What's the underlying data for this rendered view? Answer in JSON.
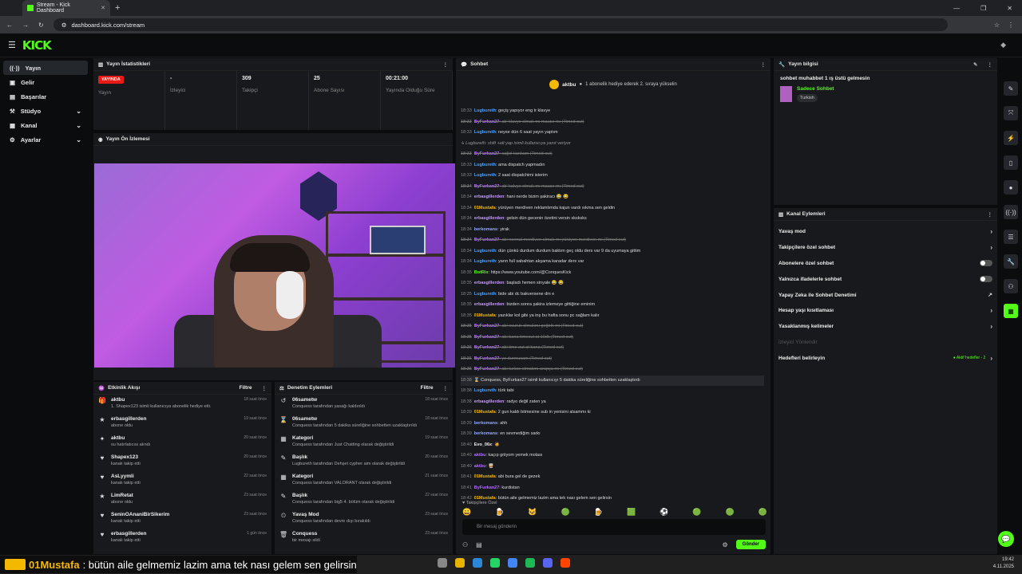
{
  "browser": {
    "tab_title": "Stream - Kick Dashboard",
    "url": "dashboard.kick.com/stream"
  },
  "app": {
    "logo": "KICK"
  },
  "sidebar": {
    "items": [
      {
        "label": "Yayın",
        "icon": "broadcast-icon",
        "active": true
      },
      {
        "label": "Gelir",
        "icon": "revenue-icon"
      },
      {
        "label": "Başarılar",
        "icon": "trophy-icon"
      },
      {
        "label": "Stüdyo",
        "icon": "studio-icon",
        "expandable": true
      },
      {
        "label": "Kanal",
        "icon": "channel-icon",
        "expandable": true
      },
      {
        "label": "Ayarlar",
        "icon": "gear-icon",
        "expandable": true
      }
    ]
  },
  "stats": {
    "title": "Yayın İstatistikleri",
    "live_badge": "YAYINDA",
    "items": [
      {
        "value": "",
        "label": "Yayın"
      },
      {
        "value": "-",
        "label": "İzleyici"
      },
      {
        "value": "309",
        "label": "Takipçi"
      },
      {
        "value": "25",
        "label": "Abone Sayısı"
      },
      {
        "value": "00:21:00",
        "label": "Yayında Olduğu Süre"
      }
    ]
  },
  "preview": {
    "title": "Yayın Ön İzlemesi"
  },
  "activity": {
    "title": "Etkinlik Akışı",
    "filter": "Filtre",
    "items": [
      {
        "name": "aktbu",
        "sub": "1. Shapex123 isimli kullanıcıya abonelik hediye etti.",
        "time": "18 saat önce"
      },
      {
        "name": "erbasgillerden",
        "sub": "abone oldu",
        "time": "19 saat önce"
      },
      {
        "name": "aktbu",
        "sub": "su hatırlatıcısı alındı",
        "time": "20 saat önce"
      },
      {
        "name": "Shapex123",
        "sub": "kanalı takip etti",
        "time": "20 saat önce"
      },
      {
        "name": "AsLyymli",
        "sub": "kanalı takip etti",
        "time": "22 saat önce"
      },
      {
        "name": "LimRetat",
        "sub": "abone oldu",
        "time": "23 saat önce"
      },
      {
        "name": "SeninOAnaniBirSikerim",
        "sub": "kanalı takip etti",
        "time": "23 saat önce"
      },
      {
        "name": "erbasgillerden",
        "sub": "kanalı takip etti",
        "time": "1 gün önce"
      }
    ]
  },
  "moderation": {
    "title": "Denetim Eylemleri",
    "filter": "Filtre",
    "items": [
      {
        "name": "06sametw",
        "sub": "Conquess tarafından yasağı kaldırıldı",
        "time": "18 saat önce"
      },
      {
        "name": "06sametw",
        "sub": "Conquess tarafından 5 dakika süreliğine sohbetten uzaklaştırıldı",
        "time": "18 saat önce"
      },
      {
        "name": "Kategori",
        "sub": "Conquess tarafından Just Chatting olarak değiştirildi",
        "time": "19 saat önce"
      },
      {
        "name": "Başlık",
        "sub": "Lugbureth tarafından Dehşet cypher aim olarak değiştirildi",
        "time": "20 saat önce"
      },
      {
        "name": "Kategori",
        "sub": "Conquess tarafından VALORANT olarak değiştirildi",
        "time": "21 saat önce"
      },
      {
        "name": "Başlık",
        "sub": "Conquess tarafından big5 4. bölüm olarak değiştirildi",
        "time": "22 saat önce"
      },
      {
        "name": "Yavaş Mod",
        "sub": "Conquess tarafından devre dışı bırakıldı",
        "time": "23 saat önce"
      },
      {
        "name": "Conquess",
        "sub": "bir mesajı sildi",
        "time": "23 saat önce"
      }
    ]
  },
  "chat": {
    "title": "Sohbet",
    "pinned_user": "aktbu",
    "pinned_text": "1 abonelik hediye ederek 2. sıraya yükselin",
    "following_note": "Takipçilere Özel",
    "placeholder": "Bir mesaj gönderin",
    "send": "Gönder",
    "messages": [
      {
        "time": "18:33",
        "user": "Lugbureth",
        "color": "#4aa3ff",
        "text": "geçiş yapıyor eng tr klavye"
      },
      {
        "time": "18:33",
        "user": "ByFurkan27",
        "color": "#b36bff",
        "text": "ab' klavye olmak mı mause mı (Timed out)",
        "del": true
      },
      {
        "time": "18:33",
        "user": "Lugbureth",
        "color": "#4aa3ff",
        "text": "neyse dün 6 saat yayın yaptım"
      },
      {
        "time": "",
        "user": "",
        "color": "#888",
        "text": "↳ Lugbureth: shift +alt yap isimli kullanıcıya yanıt veriyor",
        "sys": true
      },
      {
        "time": "18:33",
        "user": "ByFurkan27",
        "color": "#b36bff",
        "text": "sağol kankam (Timed out)",
        "del": true
      },
      {
        "time": "18:33",
        "user": "Lugbureth",
        "color": "#4aa3ff",
        "text": "ama dispatch yapmadın"
      },
      {
        "time": "18:33",
        "user": "Lugbureth",
        "color": "#4aa3ff",
        "text": "2 saat dispatchimi isterim"
      },
      {
        "time": "18:34",
        "user": "ByFurkan27",
        "color": "#b36bff",
        "text": "ab' kalvye olmak mı mause mı (Timed out)",
        "del": true
      },
      {
        "time": "18:34",
        "user": "erbasgillerden",
        "color": "#c79aff",
        "text": "hani nerde bizim şakiracı 😂 😂"
      },
      {
        "time": "18:34",
        "user": "01Mustafa",
        "color": "#f5b800",
        "text": "yürüyen merdiven reklamlımda kajun vardı sıkma sen geldin"
      },
      {
        "time": "18:34",
        "user": "erbasgillerden",
        "color": "#c79aff",
        "text": "gelsin dün gecenin özetini versin sksksks"
      },
      {
        "time": "18:34",
        "user": "berkomans",
        "color": "#8fa7ff",
        "text": "yirak"
      },
      {
        "time": "18:34",
        "user": "ByFurkan27",
        "color": "#b36bff",
        "text": "abi normal merdiven olmak mı yürüyen merdiven mi (Timed out)",
        "del": true
      },
      {
        "time": "18:34",
        "user": "Lugbureth",
        "color": "#4aa3ff",
        "text": "dün çünkü durdum durdum baktım geç oldu ders var 9 da uyumaya gittim"
      },
      {
        "time": "18:34",
        "user": "Lugbureth",
        "color": "#4aa3ff",
        "text": "yarın full sabahtan akşama karadar ders var"
      },
      {
        "time": "18:35",
        "user": "BotRix",
        "color": "#53fc18",
        "text": "https://www.youtube.com/@ConquesKick"
      },
      {
        "time": "18:35",
        "user": "erbasgillerden",
        "color": "#c79aff",
        "text": "başladı hemen sinyale 😂 😂"
      },
      {
        "time": "18:35",
        "user": "Lugbureth",
        "color": "#4aa3ff",
        "text": "bide abi dc bakversene dm e"
      },
      {
        "time": "18:35",
        "user": "erbasgillerden",
        "color": "#c79aff",
        "text": "bizden sonra şakira izlemeye gittiğine eminim"
      },
      {
        "time": "18:35",
        "user": "01Mustafa",
        "color": "#f5b800",
        "text": "yazıklar kol gibi ya inş bu hafta sonu pc sağlam kalır"
      },
      {
        "time": "18:35",
        "user": "ByFurkan27",
        "color": "#b36bff",
        "text": "abi osuruk olmakmı geğirik mi (Timed out)",
        "del": true
      },
      {
        "time": "18:35",
        "user": "ByFurkan27",
        "color": "#b36bff",
        "text": "abi bana timeout at 10dk (Timed out)",
        "del": true
      },
      {
        "time": "18:36",
        "user": "ByFurkan27",
        "color": "#b36bff",
        "text": "abi time out at bana (Timed out)",
        "del": true
      },
      {
        "time": "18:36",
        "user": "ByFurkan27",
        "color": "#b36bff",
        "text": "yo durmucam (Timed out)",
        "del": true
      },
      {
        "time": "18:36",
        "user": "ByFurkan27",
        "color": "#b36bff",
        "text": "abi turkce olmakmı arapça mı (Timed out)",
        "del": true
      },
      {
        "time": "18:38",
        "user": "",
        "color": "#eee",
        "text": "⌛ Conquess, ByFurkan27 isimli kullanıcıyı 5 dakika süreliğine sohbetten uzaklaştırdı",
        "hl": true
      },
      {
        "time": "18:38",
        "user": "Lugbureth",
        "color": "#4aa3ff",
        "text": "türk tabi"
      },
      {
        "time": "18:38",
        "user": "erbasgillerden",
        "color": "#c79aff",
        "text": "radyo değil zaten ya"
      },
      {
        "time": "18:39",
        "user": "01Mustafa",
        "color": "#f5b800",
        "text": "2 gun kaldı bitmesine sub in yenisini alsammı ki"
      },
      {
        "time": "18:39",
        "user": "berkomans",
        "color": "#8fa7ff",
        "text": "ahh"
      },
      {
        "time": "18:39",
        "user": "berkomans",
        "color": "#8fa7ff",
        "text": "en sevmediğim sarkı"
      },
      {
        "time": "18:40",
        "user": "Evo_06x",
        "color": "#eeeeee",
        "text": "🧔"
      },
      {
        "time": "18:40",
        "user": "aktbu",
        "color": "#b36bff",
        "text": "kaçıp griiyom yemek molası"
      },
      {
        "time": "18:40",
        "user": "aktbu",
        "color": "#b36bff",
        "text": "🥃"
      },
      {
        "time": "18:41",
        "user": "01Mustafa",
        "color": "#f5b800",
        "text": "abi bura gel de gezek"
      },
      {
        "time": "18:41",
        "user": "ByFurkan27",
        "color": "#b36bff",
        "text": "kurdistan"
      },
      {
        "time": "18:42",
        "user": "01Mustafa",
        "color": "#f5b800",
        "text": "bütün aile gelmemiz lazim ama tek nası gelem sen gelirsin"
      }
    ]
  },
  "stream_info": {
    "title": "Yayın bilgisi",
    "stream_title": "sohbet muhabbet 1 ış üstü gelmesin",
    "category": "Sadece Sohbet",
    "tag": "Turkish"
  },
  "channel_actions": {
    "title": "Kanal Eylemleri",
    "items": [
      {
        "label": "Yavaş mod",
        "type": "chevron"
      },
      {
        "label": "Takipçilere özel sohbet",
        "type": "chevron"
      },
      {
        "label": "Abonelere özel sohbet",
        "type": "toggle"
      },
      {
        "label": "Yalnızca ifadelerle sohbet",
        "type": "toggle"
      },
      {
        "label": "Yapay Zeka ile Sohbet Denetimi",
        "type": "link"
      },
      {
        "label": "Hesap yaşı kısıtlaması",
        "type": "chevron"
      },
      {
        "label": "Yasaklanmış kelimeler",
        "type": "chevron"
      },
      {
        "label": "İzleyici Yönlendir",
        "type": "dim"
      },
      {
        "label": "Hedefleri belirleyin",
        "type": "chevron",
        "note": "● Aktif hedefler - 2"
      }
    ]
  },
  "overlay": {
    "user": "01Mustafa",
    "message": ": bütün aile gelmemiz lazim ama tek nası gelem sen gelirsin"
  },
  "tray": {
    "time": "19:42",
    "date": "4.11.2025"
  }
}
